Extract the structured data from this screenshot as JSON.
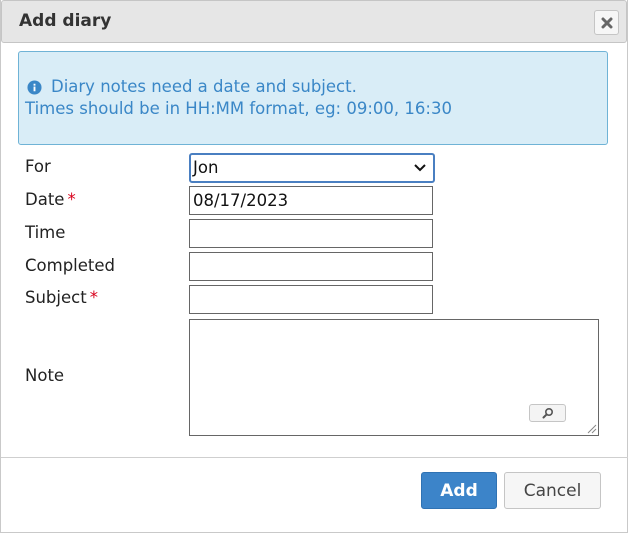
{
  "dialog": {
    "title": "Add diary",
    "close_icon": "close-icon"
  },
  "info": {
    "icon": "info-icon",
    "line1": "Diary notes need a date and subject.",
    "line2": "Times should be in HH:MM format, eg: 09:00, 16:30",
    "colors": {
      "background": "#d9edf7",
      "border": "#6fb3d6",
      "text": "#3a87c7"
    }
  },
  "form": {
    "for": {
      "label": "For",
      "value": "Jon"
    },
    "date": {
      "label": "Date",
      "required_mark": "*",
      "value": "08/17/2023"
    },
    "time": {
      "label": "Time",
      "value": ""
    },
    "completed": {
      "label": "Completed",
      "value": ""
    },
    "subject": {
      "label": "Subject",
      "required_mark": "*",
      "value": ""
    },
    "note": {
      "label": "Note",
      "value": "",
      "zoom_icon": "magnifier-icon"
    }
  },
  "buttons": {
    "add_label": "Add",
    "cancel_label": "Cancel"
  },
  "colors": {
    "primary": "#3c84c9",
    "required": "#d8001b"
  }
}
